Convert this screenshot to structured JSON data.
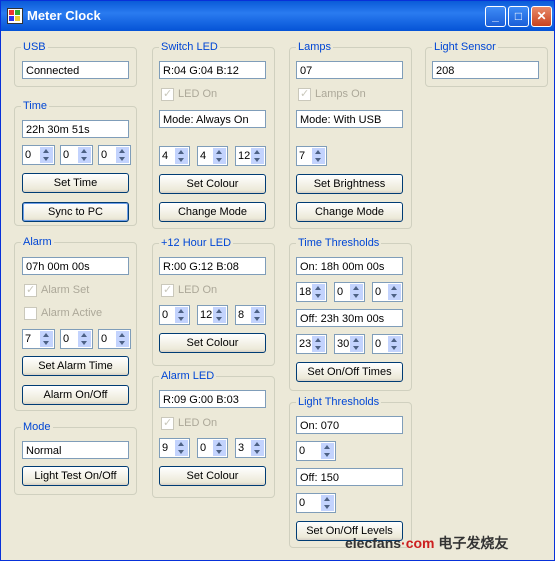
{
  "window": {
    "title": "Meter Clock",
    "minimize": "_",
    "maximize": "□",
    "close": "✕"
  },
  "usb": {
    "label": "USB",
    "status": "Connected"
  },
  "time": {
    "label": "Time",
    "value": "22h 30m 51s",
    "h": "0",
    "m": "0",
    "s": "0",
    "set": "Set Time",
    "sync": "Sync to PC"
  },
  "alarm": {
    "label": "Alarm",
    "value": "07h 00m 00s",
    "alarm_set": "Alarm Set",
    "alarm_active": "Alarm Active",
    "h": "7",
    "m": "0",
    "s": "0",
    "set": "Set Alarm Time",
    "toggle": "Alarm On/Off"
  },
  "mode": {
    "label": "Mode",
    "value": "Normal",
    "test": "Light Test On/Off"
  },
  "switch_led": {
    "label": "Switch LED",
    "rgb": "R:04  G:04  B:12",
    "led_on": "LED On",
    "mode": "Mode: Always On",
    "r": "4",
    "g": "4",
    "b": "12",
    "set_colour": "Set Colour",
    "change_mode": "Change Mode"
  },
  "hour12_led": {
    "label": "+12 Hour LED",
    "rgb": "R:00  G:12  B:08",
    "led_on": "LED On",
    "r": "0",
    "g": "12",
    "b": "8",
    "set_colour": "Set Colour"
  },
  "alarm_led": {
    "label": "Alarm LED",
    "rgb": "R:09  G:00  B:03",
    "led_on": "LED On",
    "r": "9",
    "g": "0",
    "b": "3",
    "set_colour": "Set Colour"
  },
  "lamps": {
    "label": "Lamps",
    "value": "07",
    "lamps_on": "Lamps On",
    "mode": "Mode: With USB",
    "brightness": "7",
    "set_brightness": "Set Brightness",
    "change_mode": "Change Mode"
  },
  "time_thresholds": {
    "label": "Time Thresholds",
    "on": "On: 18h 00m 00s",
    "on_h": "18",
    "on_m": "0",
    "on_s": "0",
    "off": "Off: 23h 30m 00s",
    "off_h": "23",
    "off_m": "30",
    "off_s": "0",
    "set": "Set On/Off Times"
  },
  "light_thresholds": {
    "label": "Light Thresholds",
    "on": "On: 070",
    "on_val": "0",
    "off": "Off: 150",
    "off_val": "0",
    "set": "Set On/Off Levels"
  },
  "light_sensor": {
    "label": "Light Sensor",
    "value": "208"
  },
  "watermark": {
    "text_a": "elecfans",
    "text_b": "·com",
    "text_c": "电子发烧友"
  }
}
